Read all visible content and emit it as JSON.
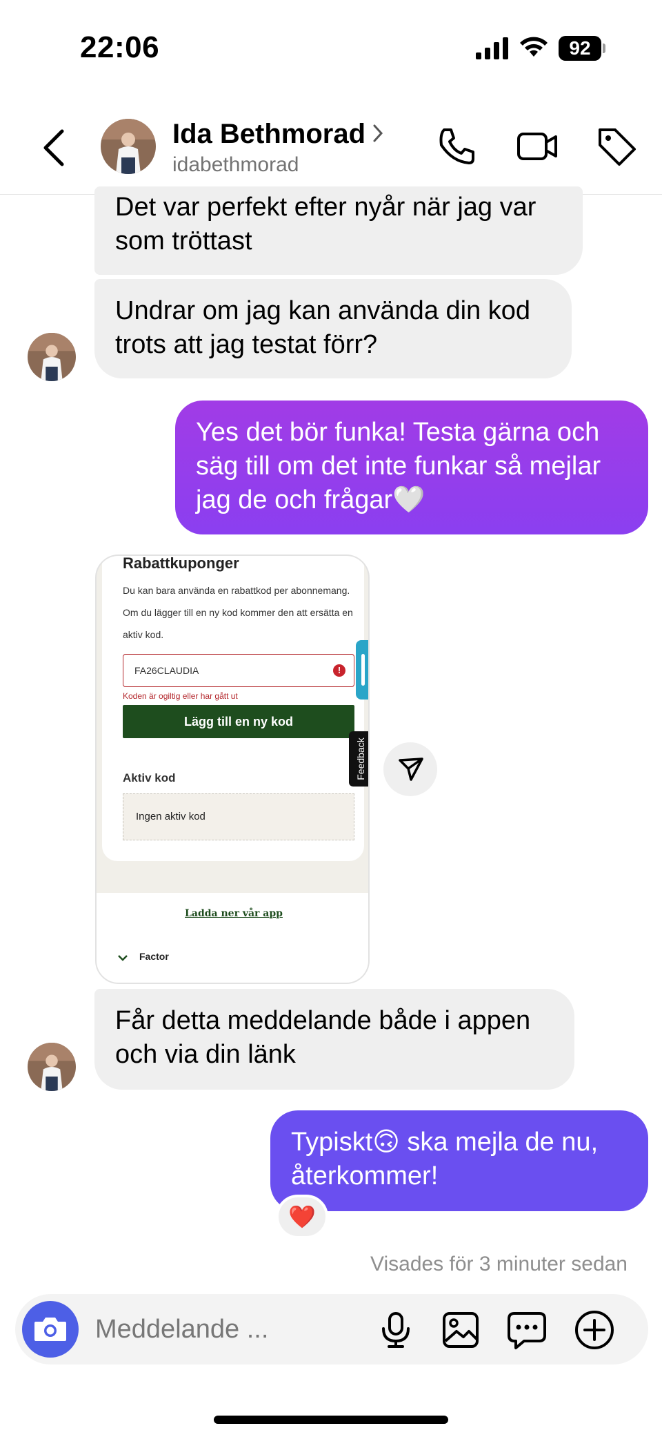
{
  "status_bar": {
    "time": "22:06",
    "battery": "92"
  },
  "header": {
    "name": "Ida Bethmorad",
    "username": "idabethmorad"
  },
  "messages": [
    {
      "direction": "in",
      "text": "Det var perfekt efter nyår när jag var som tröttast"
    },
    {
      "direction": "in",
      "text": "Undrar om jag kan använda din kod trots att jag testat förr?"
    },
    {
      "direction": "out",
      "text": "Yes det bör funka! Testa gärna och säg till om det inte funkar så mejlar jag de och frågar🤍"
    },
    {
      "direction": "in",
      "type": "image"
    },
    {
      "direction": "in",
      "text": "Får detta meddelande både i appen och via din länk"
    },
    {
      "direction": "out",
      "text": "Typiskt🙃 ska mejla de nu, återkommer!",
      "reaction": "❤️"
    }
  ],
  "screenshot": {
    "title": "Rabattkuponger",
    "description": "Du kan bara använda en rabattkod per abonnemang. Om du lägger till en ny kod kommer den att ersätta en aktiv kod.",
    "code_value": "FA26CLAUDIA",
    "error_text": "Koden är ogiltig eller har gått ut",
    "button_label": "Lägg till en ny kod",
    "active_label": "Aktiv kod",
    "active_value": "Ingen aktiv kod",
    "feedback_label": "Feedback",
    "app_link": "Ladda ner vår app",
    "footer_section": "Factor"
  },
  "seen_text": "Visades för 3 minuter sedan",
  "composer": {
    "placeholder": "Meddelande ..."
  },
  "colors": {
    "bubble_in": "#efefef",
    "bubble_out_1": "#9a3de6",
    "bubble_out_2": "#6b4ff0",
    "camera": "#4d5fe6"
  }
}
